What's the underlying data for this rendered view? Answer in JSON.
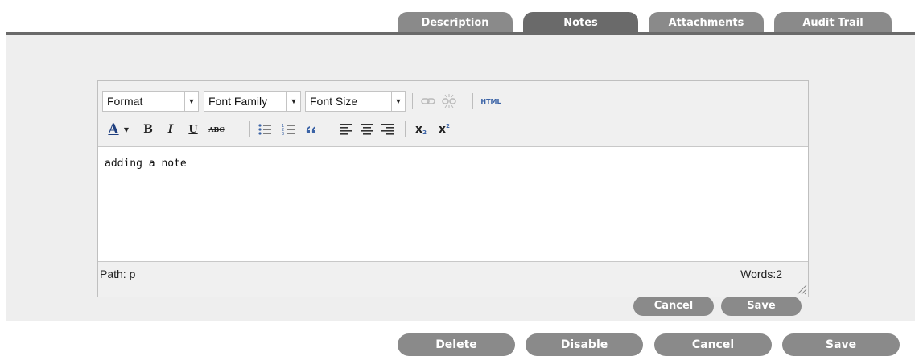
{
  "tabs": [
    {
      "label": "Description",
      "active": false
    },
    {
      "label": "Notes",
      "active": true
    },
    {
      "label": "Attachments",
      "active": false
    },
    {
      "label": "Audit Trail",
      "active": false
    }
  ],
  "editor": {
    "toolbar": {
      "format_value": "Format",
      "font_family_value": "Font Family",
      "font_size_value": "Font Size",
      "html_label": "HTML",
      "bold_label": "B",
      "italic_label": "I",
      "underline_label": "U",
      "strike_label": "ABC",
      "font_color_label": "A",
      "quote_label": "66",
      "subscript_label": "x",
      "superscript_label": "x"
    },
    "content": "adding a note",
    "path_label": "Path: p",
    "word_count": "Words:2"
  },
  "note_actions": {
    "cancel_label": "Cancel",
    "save_label": "Save"
  },
  "page_actions": {
    "delete_label": "Delete",
    "disable_label": "Disable",
    "cancel_label": "Cancel",
    "save_label": "Save"
  },
  "colors": {
    "tab": "#8a8a8a",
    "tab_active": "#6a6a6a",
    "workspace": "#eeeeee",
    "button": "#8a8a8a",
    "icon_blue": "#3b63a6"
  }
}
